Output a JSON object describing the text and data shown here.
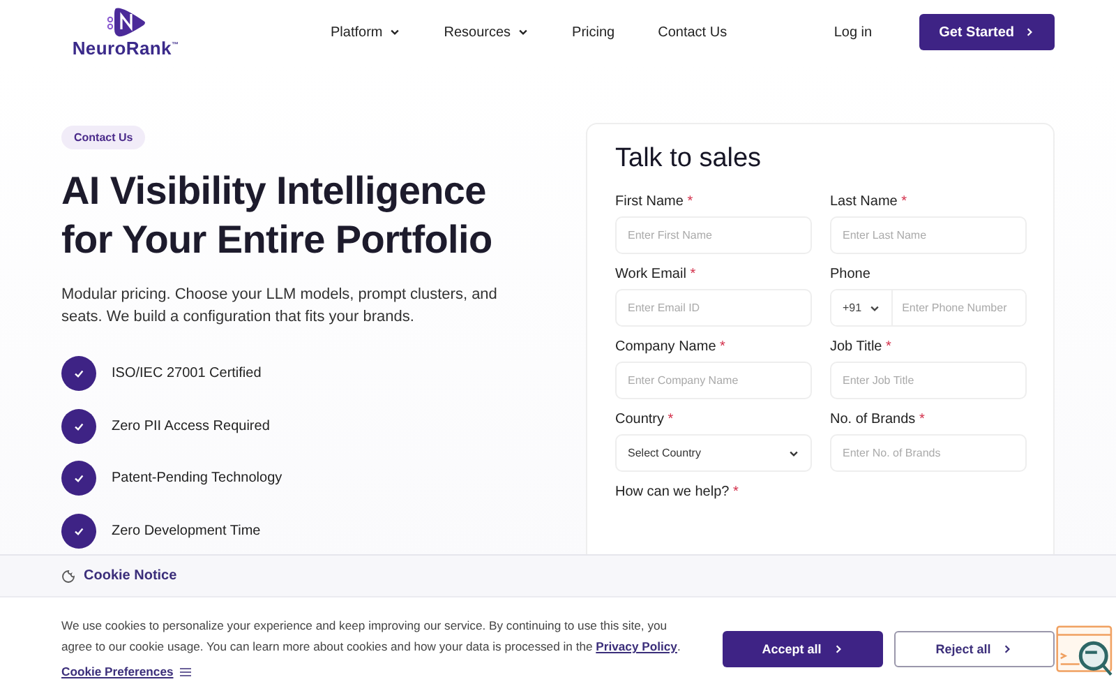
{
  "header": {
    "logo": {
      "text": "NeuroRank",
      "mark": "™"
    },
    "nav": [
      {
        "label": "Platform",
        "dropdown": true
      },
      {
        "label": "Resources",
        "dropdown": true
      },
      {
        "label": "Pricing",
        "dropdown": false
      },
      {
        "label": "Contact Us",
        "dropdown": false
      }
    ],
    "login": "Log in",
    "cta": "Get Started"
  },
  "hero": {
    "badge": "Contact Us",
    "title": "AI Visibility Intelligence for Your Entire Portfolio",
    "subtitle": "Modular pricing. Choose your LLM models, prompt clusters, and seats. We build a configuration that fits your brands.",
    "features": [
      "ISO/IEC 27001 Certified",
      "Zero PII Access Required",
      "Patent-Pending Technology",
      "Zero Development Time"
    ]
  },
  "form": {
    "title": "Talk to sales",
    "fields": [
      {
        "kind": "text",
        "label": "First Name",
        "mark": "*",
        "placeholder": "Enter First Name"
      },
      {
        "kind": "text",
        "label": "Last Name",
        "mark": "*",
        "placeholder": "Enter Last Name"
      },
      {
        "kind": "text",
        "label": "Work Email",
        "mark": "*",
        "placeholder": "Enter Email ID"
      },
      {
        "kind": "phone",
        "label": "Phone",
        "prefix": "+91",
        "placeholder": "Enter Phone Number"
      },
      {
        "kind": "text",
        "label": "Company Name",
        "mark": "*",
        "placeholder": "Enter Company Name"
      },
      {
        "kind": "text",
        "label": "Job Title",
        "mark": "*",
        "placeholder": "Enter Job Title"
      },
      {
        "kind": "select",
        "label": "Country",
        "mark": "*",
        "value": "Select Country"
      },
      {
        "kind": "text",
        "label": "No. of Brands",
        "mark": "*",
        "placeholder": "Enter No. of Brands"
      },
      {
        "kind": "label",
        "label": "How can we help?",
        "mark": "*"
      }
    ]
  },
  "cookie": {
    "title": "Cookie Notice",
    "text": "We use cookies to personalize your experience and keep improving our service. By continuing to use this site, you agree to our cookie usage. You can learn more about cookies and how your data is processed in the ",
    "link": "Privacy Policy",
    "end": ".",
    "preferences": "Cookie Preferences",
    "accept": "Accept all",
    "reject": "Reject all"
  }
}
